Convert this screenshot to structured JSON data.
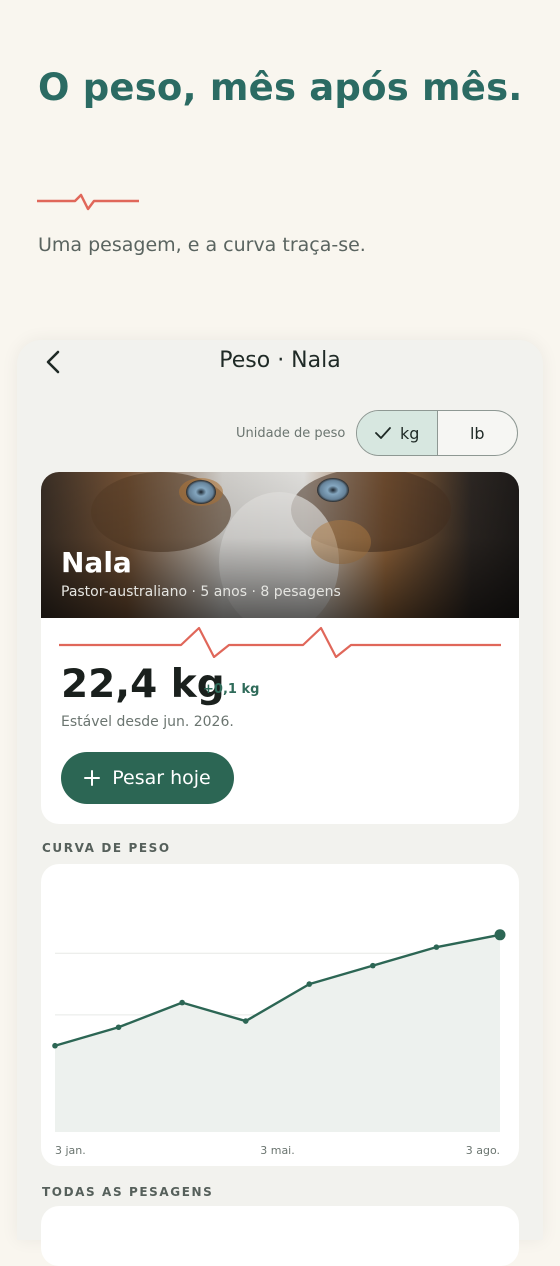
{
  "hero": {
    "title": "O peso, mês após mês.",
    "subtitle": "Uma pesagem, e a curva traça-se."
  },
  "colors": {
    "accent_teal": "#2b6b63",
    "button_green": "#2c6654",
    "pulse_red": "#e0675a",
    "background": "#f9f6ef"
  },
  "screen": {
    "back_icon": "chevron-left-icon",
    "title": "Peso · Nala"
  },
  "unit_selector": {
    "label": "Unidade de peso",
    "options": [
      {
        "label": "kg",
        "selected": true,
        "icon": "check-icon"
      },
      {
        "label": "lb",
        "selected": false
      }
    ]
  },
  "pet": {
    "name": "Nala",
    "meta": "Pastor-australiano · 5 anos · 8 pesagens",
    "current_weight": "22,4 kg",
    "delta": "+0,1 kg",
    "stable_since": "Estável desde jun. 2026.",
    "weigh_button": "Pesar hoje",
    "weigh_icon": "plus-icon"
  },
  "sections": {
    "curve": "CURVA DE PESO",
    "all_weighings": "TODAS AS PESAGENS"
  },
  "chart_data": {
    "type": "area",
    "title": "",
    "xlabel": "",
    "ylabel": "",
    "x_tick_labels": [
      "3 jan.",
      "3 mai.",
      "3 ago."
    ],
    "x_days": [
      0,
      30,
      60,
      90,
      120,
      150,
      180,
      210
    ],
    "values": [
      20.6,
      20.9,
      21.3,
      21.0,
      21.6,
      21.9,
      22.2,
      22.4
    ],
    "ylim": [
      19.2,
      22.9
    ],
    "gridlines_y": [
      20.1,
      21.1,
      22.1
    ],
    "grid": true,
    "legend": "none",
    "highlight_last": true
  }
}
